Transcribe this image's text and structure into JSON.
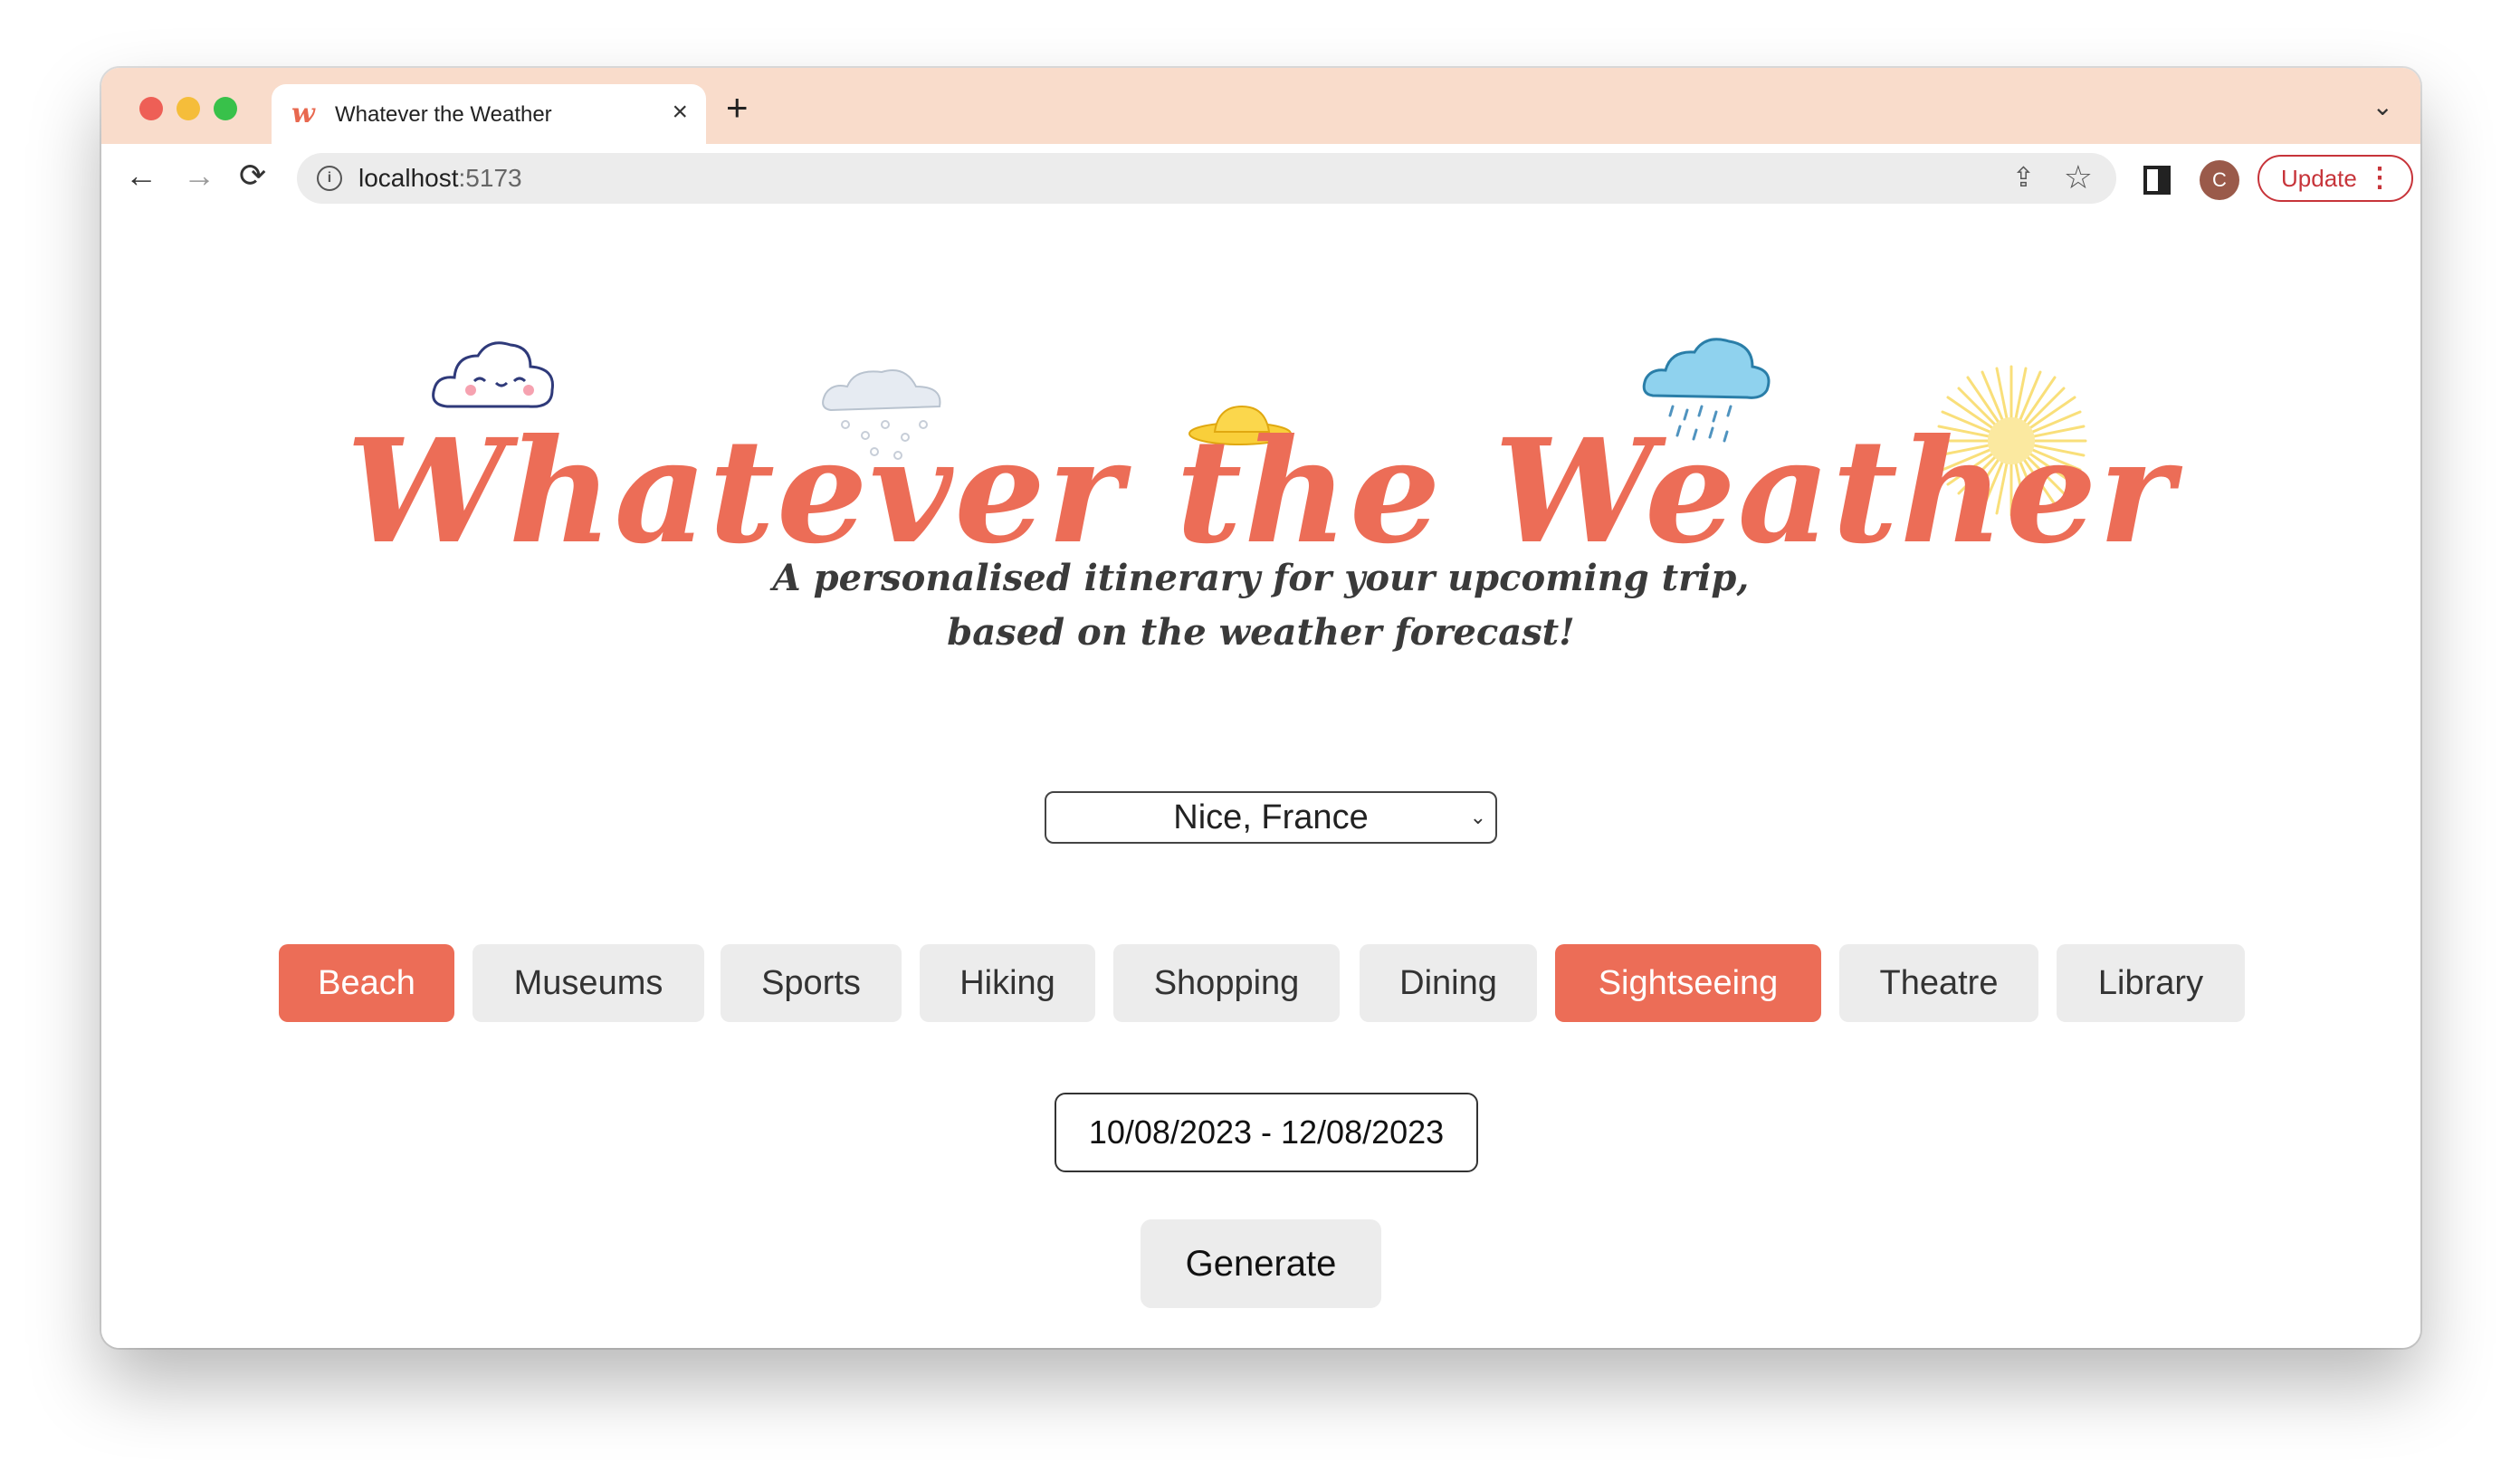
{
  "browser": {
    "tab_title": "Whatever the Weather",
    "tab_favicon": "w",
    "tab_close": "×",
    "new_tab": "+",
    "tabs_menu": "⌄",
    "url_host": "localhost",
    "url_port": ":5173",
    "info_icon": "i",
    "avatar_letter": "C",
    "update_label": "Update",
    "update_menu": "⋮",
    "back": "←",
    "forward": "→",
    "reload": "⟳",
    "share": "⇪",
    "star": "☆"
  },
  "hero": {
    "logo_text": "Whatever the Weather",
    "tagline_line1": "A personalised itinerary for your upcoming trip,",
    "tagline_line2": "based on the weather forecast!"
  },
  "form": {
    "city_value": "Nice, France",
    "city_chevron": "⌄",
    "activities": [
      {
        "label": "Beach",
        "selected": true
      },
      {
        "label": "Museums",
        "selected": false
      },
      {
        "label": "Sports",
        "selected": false
      },
      {
        "label": "Hiking",
        "selected": false
      },
      {
        "label": "Shopping",
        "selected": false
      },
      {
        "label": "Dining",
        "selected": false
      },
      {
        "label": "Sightseeing",
        "selected": true
      },
      {
        "label": "Theatre",
        "selected": false
      },
      {
        "label": "Library",
        "selected": false
      }
    ],
    "date_range": "10/08/2023 - 12/08/2023",
    "generate_label": "Generate"
  },
  "colors": {
    "accent": "#ec6d57",
    "titlebar": "#f9dccb",
    "button_bg": "#ececec"
  }
}
